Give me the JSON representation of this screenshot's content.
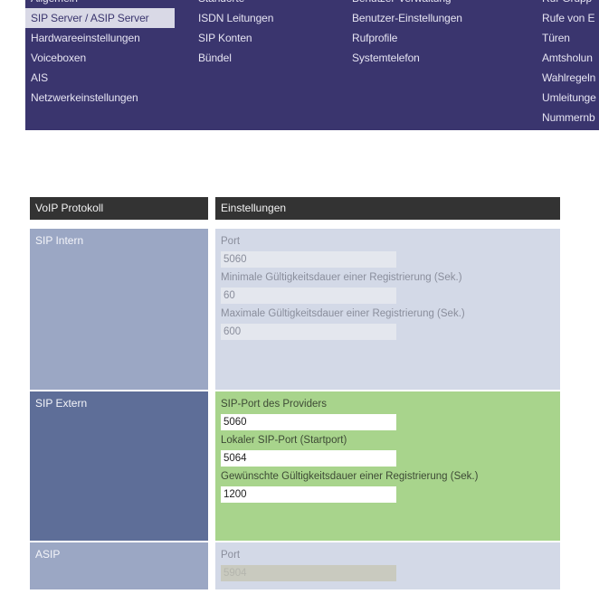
{
  "nav": {
    "col1": [
      "Allgemein",
      "SIP Server / ASIP Server",
      "Hardwareeinstellungen",
      "Voiceboxen",
      "AIS",
      "Netzwerkeinstellungen"
    ],
    "col2": [
      "Standorte",
      "ISDN Leitungen",
      "SIP Konten",
      "Bündel"
    ],
    "col3": [
      "Benutzer-Verwaltung",
      "Benutzer-Einstellungen",
      "Rufprofile",
      "Systemtelefon"
    ],
    "col4": [
      "Ruf-Grupp",
      "Rufe von E",
      "Türen",
      "Amtsholun",
      "Wahlregeln",
      "Umleitunge",
      "Nummernb"
    ],
    "active": "SIP Server / ASIP Server"
  },
  "table": {
    "header_left": "VoIP Protokoll",
    "header_right": "Einstellungen",
    "sip_intern": {
      "name": "SIP Intern",
      "port_label": "Port",
      "port_value": "5060",
      "min_label": "Minimale Gültigkeitsdauer einer Registrierung (Sek.)",
      "min_value": "60",
      "max_label": "Maximale Gültigkeitsdauer einer Registrierung (Sek.)",
      "max_value": "600"
    },
    "sip_extern": {
      "name": "SIP Extern",
      "provider_port_label": "SIP-Port des Providers",
      "provider_port_value": "5060",
      "local_port_label": "Lokaler SIP-Port (Startport)",
      "local_port_value": "5064",
      "duration_label": "Gewünschte Gültigkeitsdauer einer Registrierung (Sek.)",
      "duration_value": "1200"
    },
    "asip": {
      "name": "ASIP",
      "port_label": "Port",
      "port_value": "5904"
    }
  }
}
